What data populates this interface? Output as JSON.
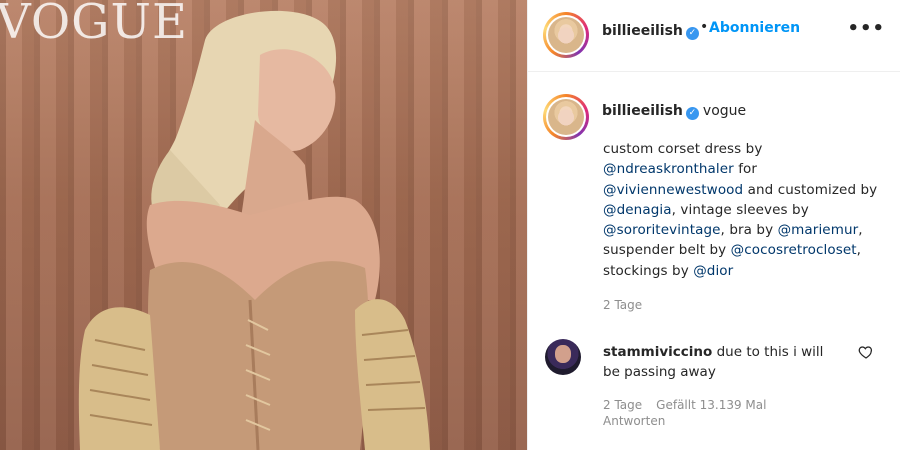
{
  "photo": {
    "magazine_text": "VOGUE"
  },
  "header": {
    "username": "billieeilish",
    "verified_icon": "verified-badge-icon",
    "separator": "•",
    "follow_label": "Abonnieren",
    "more_label": "•••"
  },
  "caption": {
    "username": "billieeilish",
    "location": "vogue",
    "segments": [
      {
        "type": "text",
        "value": "custom corset dress by "
      },
      {
        "type": "mention",
        "value": "@ndreaskronthaler"
      },
      {
        "type": "text",
        "value": " for "
      },
      {
        "type": "mention",
        "value": "@viviennewestwood"
      },
      {
        "type": "text",
        "value": " and customized by "
      },
      {
        "type": "mention",
        "value": "@denagia"
      },
      {
        "type": "text",
        "value": ", vintage sleeves by "
      },
      {
        "type": "mention",
        "value": "@sororitevintage"
      },
      {
        "type": "text",
        "value": ", bra by "
      },
      {
        "type": "mention",
        "value": "@mariemur"
      },
      {
        "type": "text",
        "value": ", suspender belt by "
      },
      {
        "type": "mention",
        "value": "@cocosretrocloset"
      },
      {
        "type": "text",
        "value": ", stockings by "
      },
      {
        "type": "mention",
        "value": "@dior"
      }
    ],
    "time": "2 Tage"
  },
  "comment": {
    "username": "stammiviccino",
    "text": " due to this i will be passing away",
    "time": "2 Tage",
    "likes": "Gefällt 13.139 Mal",
    "reply_label": "Antworten",
    "like_icon": "heart-icon"
  },
  "colors": {
    "link": "#0095f6",
    "mention": "#00376b",
    "muted": "#8e8e8e",
    "verified": "#3897f0"
  }
}
